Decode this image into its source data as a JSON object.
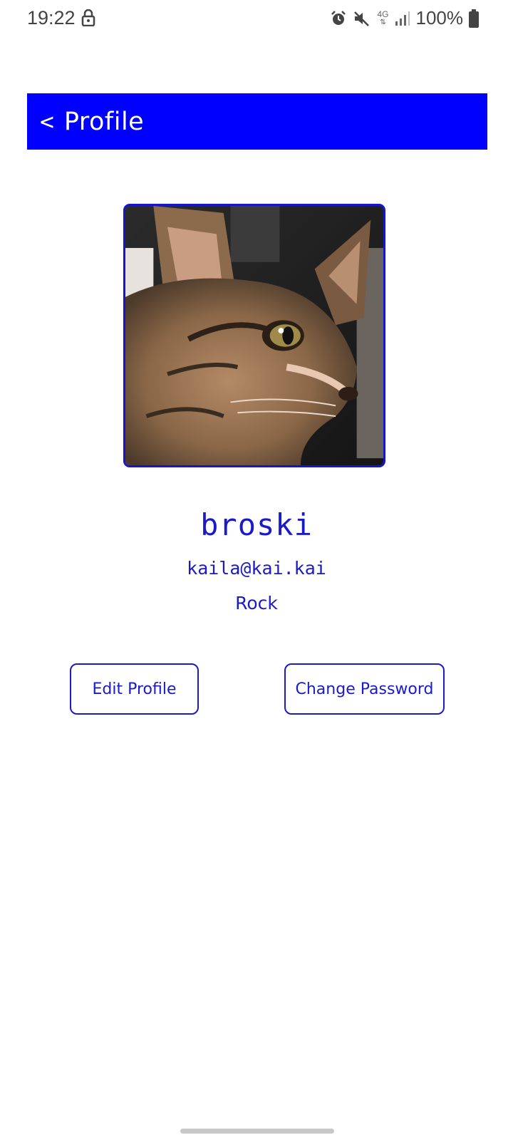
{
  "status_bar": {
    "time": "19:22",
    "network": "4G",
    "battery": "100%",
    "icons": [
      "lock-icon",
      "alarm-icon",
      "mute-icon",
      "signal-icon",
      "battery-icon"
    ]
  },
  "header": {
    "back_glyph": "<",
    "title": "Profile",
    "background": "#0000ff"
  },
  "profile": {
    "username": "broski",
    "email": "kaila@kai.kai",
    "genre": "Rock",
    "accent_color": "#1a1ac8"
  },
  "actions": {
    "edit_label": "Edit Profile",
    "change_password_label": "Change Password"
  }
}
